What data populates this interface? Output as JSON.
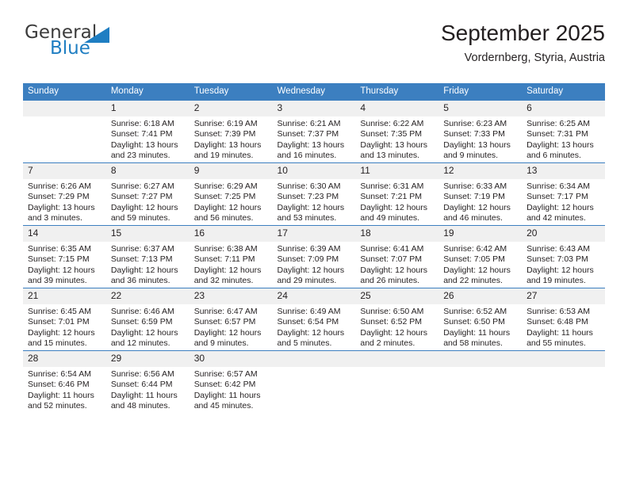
{
  "brand": {
    "name_top": "General",
    "name_bottom": "Blue",
    "triangle_icon": "triangle-icon",
    "colors": {
      "blue": "#1f7ec2",
      "dark": "#3b3b3b"
    }
  },
  "header": {
    "title": "September 2025",
    "subtitle": "Vordernberg, Styria, Austria"
  },
  "theme": {
    "header_blue": "#3c7fc0",
    "daynum_band": "#f0f0f0",
    "text": "#231f20"
  },
  "calendar": {
    "weekday_headers": [
      "Sunday",
      "Monday",
      "Tuesday",
      "Wednesday",
      "Thursday",
      "Friday",
      "Saturday"
    ],
    "weeks": [
      [
        {
          "day": "",
          "empty": true
        },
        {
          "day": "1",
          "sunrise": "Sunrise: 6:18 AM",
          "sunset": "Sunset: 7:41 PM",
          "daylight_line1": "Daylight: 13 hours",
          "daylight_line2": "and 23 minutes."
        },
        {
          "day": "2",
          "sunrise": "Sunrise: 6:19 AM",
          "sunset": "Sunset: 7:39 PM",
          "daylight_line1": "Daylight: 13 hours",
          "daylight_line2": "and 19 minutes."
        },
        {
          "day": "3",
          "sunrise": "Sunrise: 6:21 AM",
          "sunset": "Sunset: 7:37 PM",
          "daylight_line1": "Daylight: 13 hours",
          "daylight_line2": "and 16 minutes."
        },
        {
          "day": "4",
          "sunrise": "Sunrise: 6:22 AM",
          "sunset": "Sunset: 7:35 PM",
          "daylight_line1": "Daylight: 13 hours",
          "daylight_line2": "and 13 minutes."
        },
        {
          "day": "5",
          "sunrise": "Sunrise: 6:23 AM",
          "sunset": "Sunset: 7:33 PM",
          "daylight_line1": "Daylight: 13 hours",
          "daylight_line2": "and 9 minutes."
        },
        {
          "day": "6",
          "sunrise": "Sunrise: 6:25 AM",
          "sunset": "Sunset: 7:31 PM",
          "daylight_line1": "Daylight: 13 hours",
          "daylight_line2": "and 6 minutes."
        }
      ],
      [
        {
          "day": "7",
          "sunrise": "Sunrise: 6:26 AM",
          "sunset": "Sunset: 7:29 PM",
          "daylight_line1": "Daylight: 13 hours",
          "daylight_line2": "and 3 minutes."
        },
        {
          "day": "8",
          "sunrise": "Sunrise: 6:27 AM",
          "sunset": "Sunset: 7:27 PM",
          "daylight_line1": "Daylight: 12 hours",
          "daylight_line2": "and 59 minutes."
        },
        {
          "day": "9",
          "sunrise": "Sunrise: 6:29 AM",
          "sunset": "Sunset: 7:25 PM",
          "daylight_line1": "Daylight: 12 hours",
          "daylight_line2": "and 56 minutes."
        },
        {
          "day": "10",
          "sunrise": "Sunrise: 6:30 AM",
          "sunset": "Sunset: 7:23 PM",
          "daylight_line1": "Daylight: 12 hours",
          "daylight_line2": "and 53 minutes."
        },
        {
          "day": "11",
          "sunrise": "Sunrise: 6:31 AM",
          "sunset": "Sunset: 7:21 PM",
          "daylight_line1": "Daylight: 12 hours",
          "daylight_line2": "and 49 minutes."
        },
        {
          "day": "12",
          "sunrise": "Sunrise: 6:33 AM",
          "sunset": "Sunset: 7:19 PM",
          "daylight_line1": "Daylight: 12 hours",
          "daylight_line2": "and 46 minutes."
        },
        {
          "day": "13",
          "sunrise": "Sunrise: 6:34 AM",
          "sunset": "Sunset: 7:17 PM",
          "daylight_line1": "Daylight: 12 hours",
          "daylight_line2": "and 42 minutes."
        }
      ],
      [
        {
          "day": "14",
          "sunrise": "Sunrise: 6:35 AM",
          "sunset": "Sunset: 7:15 PM",
          "daylight_line1": "Daylight: 12 hours",
          "daylight_line2": "and 39 minutes."
        },
        {
          "day": "15",
          "sunrise": "Sunrise: 6:37 AM",
          "sunset": "Sunset: 7:13 PM",
          "daylight_line1": "Daylight: 12 hours",
          "daylight_line2": "and 36 minutes."
        },
        {
          "day": "16",
          "sunrise": "Sunrise: 6:38 AM",
          "sunset": "Sunset: 7:11 PM",
          "daylight_line1": "Daylight: 12 hours",
          "daylight_line2": "and 32 minutes."
        },
        {
          "day": "17",
          "sunrise": "Sunrise: 6:39 AM",
          "sunset": "Sunset: 7:09 PM",
          "daylight_line1": "Daylight: 12 hours",
          "daylight_line2": "and 29 minutes."
        },
        {
          "day": "18",
          "sunrise": "Sunrise: 6:41 AM",
          "sunset": "Sunset: 7:07 PM",
          "daylight_line1": "Daylight: 12 hours",
          "daylight_line2": "and 26 minutes."
        },
        {
          "day": "19",
          "sunrise": "Sunrise: 6:42 AM",
          "sunset": "Sunset: 7:05 PM",
          "daylight_line1": "Daylight: 12 hours",
          "daylight_line2": "and 22 minutes."
        },
        {
          "day": "20",
          "sunrise": "Sunrise: 6:43 AM",
          "sunset": "Sunset: 7:03 PM",
          "daylight_line1": "Daylight: 12 hours",
          "daylight_line2": "and 19 minutes."
        }
      ],
      [
        {
          "day": "21",
          "sunrise": "Sunrise: 6:45 AM",
          "sunset": "Sunset: 7:01 PM",
          "daylight_line1": "Daylight: 12 hours",
          "daylight_line2": "and 15 minutes."
        },
        {
          "day": "22",
          "sunrise": "Sunrise: 6:46 AM",
          "sunset": "Sunset: 6:59 PM",
          "daylight_line1": "Daylight: 12 hours",
          "daylight_line2": "and 12 minutes."
        },
        {
          "day": "23",
          "sunrise": "Sunrise: 6:47 AM",
          "sunset": "Sunset: 6:57 PM",
          "daylight_line1": "Daylight: 12 hours",
          "daylight_line2": "and 9 minutes."
        },
        {
          "day": "24",
          "sunrise": "Sunrise: 6:49 AM",
          "sunset": "Sunset: 6:54 PM",
          "daylight_line1": "Daylight: 12 hours",
          "daylight_line2": "and 5 minutes."
        },
        {
          "day": "25",
          "sunrise": "Sunrise: 6:50 AM",
          "sunset": "Sunset: 6:52 PM",
          "daylight_line1": "Daylight: 12 hours",
          "daylight_line2": "and 2 minutes."
        },
        {
          "day": "26",
          "sunrise": "Sunrise: 6:52 AM",
          "sunset": "Sunset: 6:50 PM",
          "daylight_line1": "Daylight: 11 hours",
          "daylight_line2": "and 58 minutes."
        },
        {
          "day": "27",
          "sunrise": "Sunrise: 6:53 AM",
          "sunset": "Sunset: 6:48 PM",
          "daylight_line1": "Daylight: 11 hours",
          "daylight_line2": "and 55 minutes."
        }
      ],
      [
        {
          "day": "28",
          "sunrise": "Sunrise: 6:54 AM",
          "sunset": "Sunset: 6:46 PM",
          "daylight_line1": "Daylight: 11 hours",
          "daylight_line2": "and 52 minutes."
        },
        {
          "day": "29",
          "sunrise": "Sunrise: 6:56 AM",
          "sunset": "Sunset: 6:44 PM",
          "daylight_line1": "Daylight: 11 hours",
          "daylight_line2": "and 48 minutes."
        },
        {
          "day": "30",
          "sunrise": "Sunrise: 6:57 AM",
          "sunset": "Sunset: 6:42 PM",
          "daylight_line1": "Daylight: 11 hours",
          "daylight_line2": "and 45 minutes."
        },
        {
          "day": "",
          "empty": true
        },
        {
          "day": "",
          "empty": true
        },
        {
          "day": "",
          "empty": true
        },
        {
          "day": "",
          "empty": true
        }
      ]
    ]
  }
}
